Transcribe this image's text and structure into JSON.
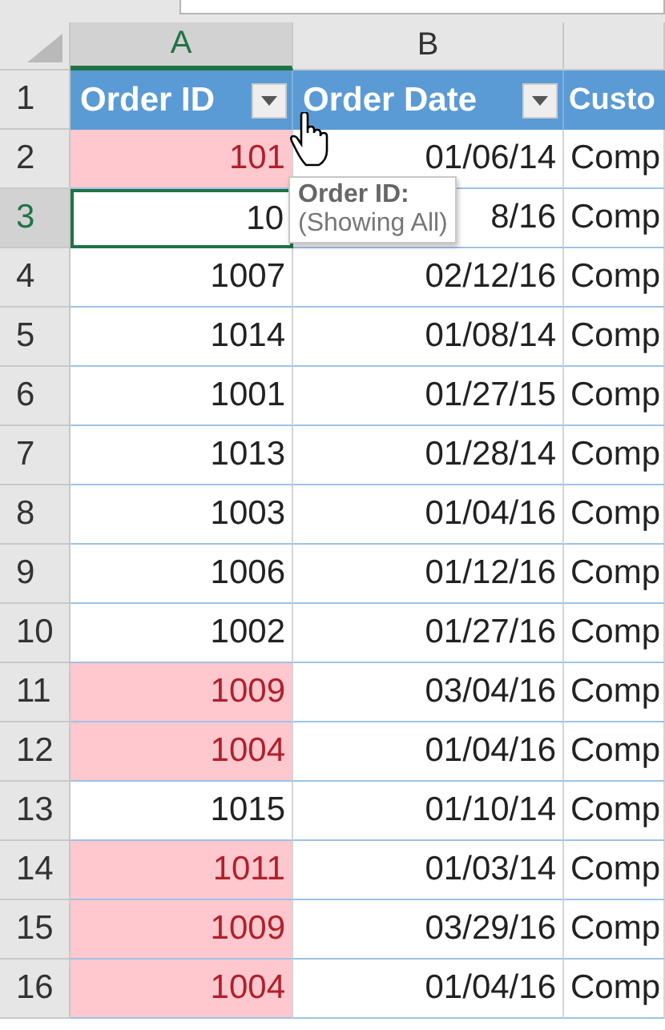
{
  "column_headers": [
    {
      "label": "A",
      "selected": true
    },
    {
      "label": "B",
      "selected": false
    }
  ],
  "header_row": {
    "number": "1",
    "cells": [
      {
        "label": "Order ID",
        "filter": true
      },
      {
        "label": "Order Date",
        "filter": true
      },
      {
        "label": "Custo"
      }
    ]
  },
  "rows": [
    {
      "number": "2",
      "selected": false,
      "highlighted": true,
      "order_id": "101",
      "order_date": "01/06/14",
      "customer": "Comp"
    },
    {
      "number": "3",
      "selected": true,
      "highlighted": false,
      "order_id": "10",
      "order_date": "8/16",
      "customer": "Comp"
    },
    {
      "number": "4",
      "selected": false,
      "highlighted": false,
      "order_id": "1007",
      "order_date": "02/12/16",
      "customer": "Comp"
    },
    {
      "number": "5",
      "selected": false,
      "highlighted": false,
      "order_id": "1014",
      "order_date": "01/08/14",
      "customer": "Comp"
    },
    {
      "number": "6",
      "selected": false,
      "highlighted": false,
      "order_id": "1001",
      "order_date": "01/27/15",
      "customer": "Comp"
    },
    {
      "number": "7",
      "selected": false,
      "highlighted": false,
      "order_id": "1013",
      "order_date": "01/28/14",
      "customer": "Comp"
    },
    {
      "number": "8",
      "selected": false,
      "highlighted": false,
      "order_id": "1003",
      "order_date": "01/04/16",
      "customer": "Comp"
    },
    {
      "number": "9",
      "selected": false,
      "highlighted": false,
      "order_id": "1006",
      "order_date": "01/12/16",
      "customer": "Comp"
    },
    {
      "number": "10",
      "selected": false,
      "highlighted": false,
      "order_id": "1002",
      "order_date": "01/27/16",
      "customer": "Comp"
    },
    {
      "number": "11",
      "selected": false,
      "highlighted": true,
      "order_id": "1009",
      "order_date": "03/04/16",
      "customer": "Comp"
    },
    {
      "number": "12",
      "selected": false,
      "highlighted": true,
      "order_id": "1004",
      "order_date": "01/04/16",
      "customer": "Comp"
    },
    {
      "number": "13",
      "selected": false,
      "highlighted": false,
      "order_id": "1015",
      "order_date": "01/10/14",
      "customer": "Comp"
    },
    {
      "number": "14",
      "selected": false,
      "highlighted": true,
      "order_id": "1011",
      "order_date": "01/03/14",
      "customer": "Comp"
    },
    {
      "number": "15",
      "selected": false,
      "highlighted": true,
      "order_id": "1009",
      "order_date": "03/29/16",
      "customer": "Comp"
    },
    {
      "number": "16",
      "selected": false,
      "highlighted": true,
      "order_id": "1004",
      "order_date": "01/04/16",
      "customer": "Comp"
    }
  ],
  "tooltip": {
    "title": "Order ID:",
    "text": "(Showing All)"
  }
}
